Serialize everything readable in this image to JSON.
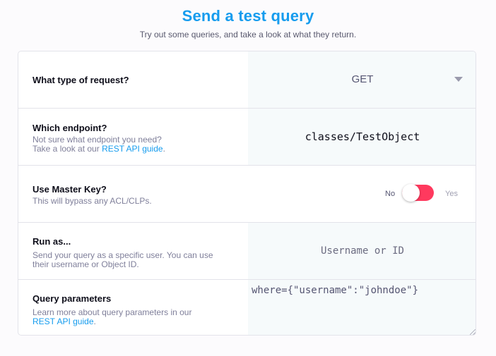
{
  "header": {
    "title": "Send a test query",
    "subtitle": "Try out some queries, and take a look at what they return."
  },
  "request_type": {
    "label": "What type of request?",
    "value": "GET"
  },
  "endpoint": {
    "label": "Which endpoint?",
    "desc_line1": "Not sure what endpoint you need?",
    "desc_prefix": "Take a look at our ",
    "desc_link": "REST API guide",
    "desc_suffix": ".",
    "value": "classes/TestObject"
  },
  "master_key": {
    "label": "Use Master Key?",
    "desc": "This will bypass any ACL/CLPs.",
    "off_label": "No",
    "on_label": "Yes",
    "enabled": false
  },
  "run_as": {
    "label": "Run as...",
    "desc_line1": "Send your query as a specific user. You can use",
    "desc_line2": "their username or Object ID.",
    "placeholder": "Username or ID"
  },
  "query_params": {
    "label": "Query parameters",
    "desc_line1": "Learn more about query parameters in our",
    "desc_link": "REST API guide",
    "desc_suffix": ".",
    "value": "where={\"username\":\"johndoe\"}"
  },
  "colors": {
    "accent": "#169cee",
    "toggle": "#ff395e"
  }
}
